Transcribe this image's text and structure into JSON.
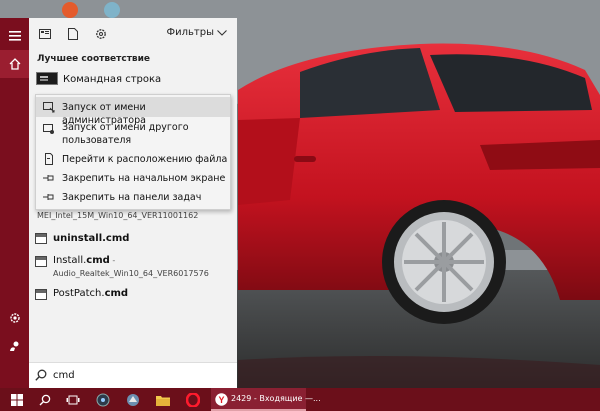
{
  "panel": {
    "filters_label": "Фильтры",
    "section_heading": "Лучшее соответствие",
    "best_match": {
      "label": "Командная строка",
      "icon": "cmd-icon"
    }
  },
  "context_menu": {
    "items": [
      {
        "label": "Запуск от имени администратора",
        "icon": "run-as-admin-icon"
      },
      {
        "label": "Запуск от имени другого",
        "label2": "пользователя",
        "icon": "run-as-user-icon"
      },
      {
        "label": "Перейти к расположению файла",
        "icon": "file-location-icon"
      },
      {
        "label": "Закрепить на начальном экране",
        "icon": "pin-icon"
      },
      {
        "label": "Закрепить на панели задач",
        "icon": "pin-icon"
      }
    ]
  },
  "results": [
    {
      "subtitle": "MEI_Intel_15M_Win10_64_VER11001162"
    },
    {
      "title_bold": "uninstall.cmd",
      "title_rest": ""
    },
    {
      "title_prefix": "Install.",
      "title_bold": "cmd",
      "title_rest": " -",
      "subtitle": "Audio_Realtek_Win10_64_VER6017576"
    },
    {
      "title_prefix": "PostPatch.",
      "title_bold": "cmd",
      "title_rest": ""
    }
  ],
  "search": {
    "value": "cmd"
  },
  "taskbar": {
    "yandex_task_label": "2429 - Входящие —..."
  },
  "colors": {
    "accent": "#7a0e1e",
    "taskbar": "#6b0f1a",
    "panel": "#f2f2f2"
  }
}
